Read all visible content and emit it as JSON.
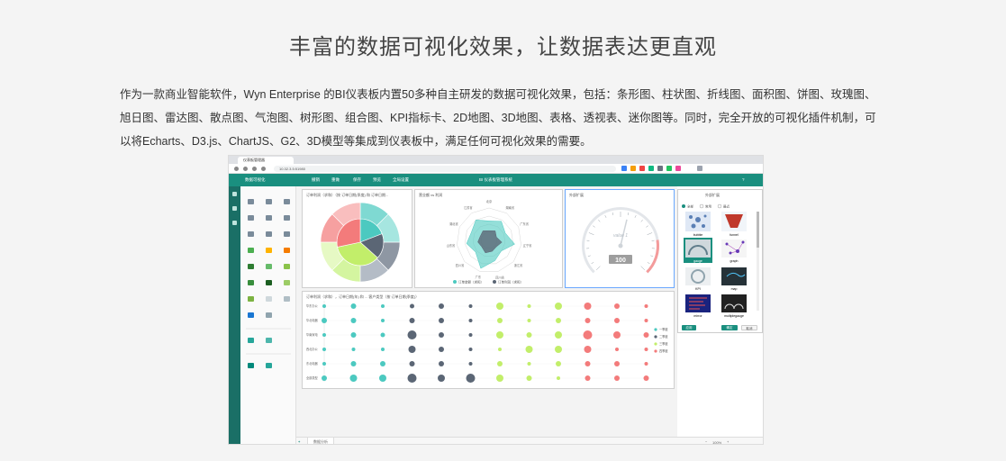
{
  "heading": "丰富的数据可视化效果，让数据表达更直观",
  "intro": "作为一款商业智能软件，Wyn Enterprise 的BI仪表板内置50多种自主研发的数据可视化效果，包括：条形图、柱状图、折线图、面积图、饼图、玫瑰图、旭日图、雷达图、散点图、气泡图、树形图、组合图、KPI指标卡、2D地图、3D地图、表格、透视表、迷你图等。同时，完全开放的可视化插件机制，可以将Echarts、D3.js、ChartJS、G2、3D模型等集成到仪表板中，满足任何可视化效果的需要。",
  "browser": {
    "tab_label": "仪表板管理器",
    "address": "10.32.3.5:51980"
  },
  "app": {
    "title": "数据可视化",
    "center_title": "BI 仪表板管理系统",
    "tools": [
      "撤销",
      "重做",
      "保存",
      "预览",
      "全局设置"
    ]
  },
  "panels": {
    "sunburst_title": "订单利润（求和）（按 订单日期(季度) 和 订单日期...",
    "radar_title": "营业额 vs 利润",
    "gauge_title": "外部扩展",
    "bubble_title": "订单利润（求和），订单日期(年) 和 ... 客户类型（按 订单日期(季度)）",
    "gauge_value": "100",
    "gauge_unit": "value 1"
  },
  "radar": {
    "axes": [
      "北京",
      "湖南省",
      "广东省",
      "辽宁省",
      "浙江省",
      "四川省",
      "广东",
      "四川省",
      "山东省",
      "湖北省",
      "江苏省"
    ],
    "legend": [
      "订单金额（求和）",
      "订单利润（求和）"
    ]
  },
  "bubble": {
    "rows": [
      "华东办公",
      "华北电器",
      "华南家电",
      "西北办公",
      "东北电器",
      "全部类型"
    ],
    "legend": [
      "一季度",
      "二季度",
      "三季度",
      "四季度"
    ]
  },
  "right_panel": {
    "title": "外部扩展",
    "filters": [
      "全部",
      "常用",
      "最近"
    ],
    "items": [
      "bubble",
      "funnel",
      "gauge",
      "graph",
      "KPI",
      "map",
      "mirror",
      "multiplegauge"
    ],
    "buttons": [
      "应用",
      "确定",
      "取消"
    ]
  },
  "bottom": {
    "sheet": "数据分析",
    "zoom": "100%"
  },
  "colors": {
    "teal": "#1a8f7f",
    "turquoise": "#4cc9c0",
    "slate": "#5b6675",
    "lime": "#c2ee6a",
    "coral": "#f37b7b"
  }
}
